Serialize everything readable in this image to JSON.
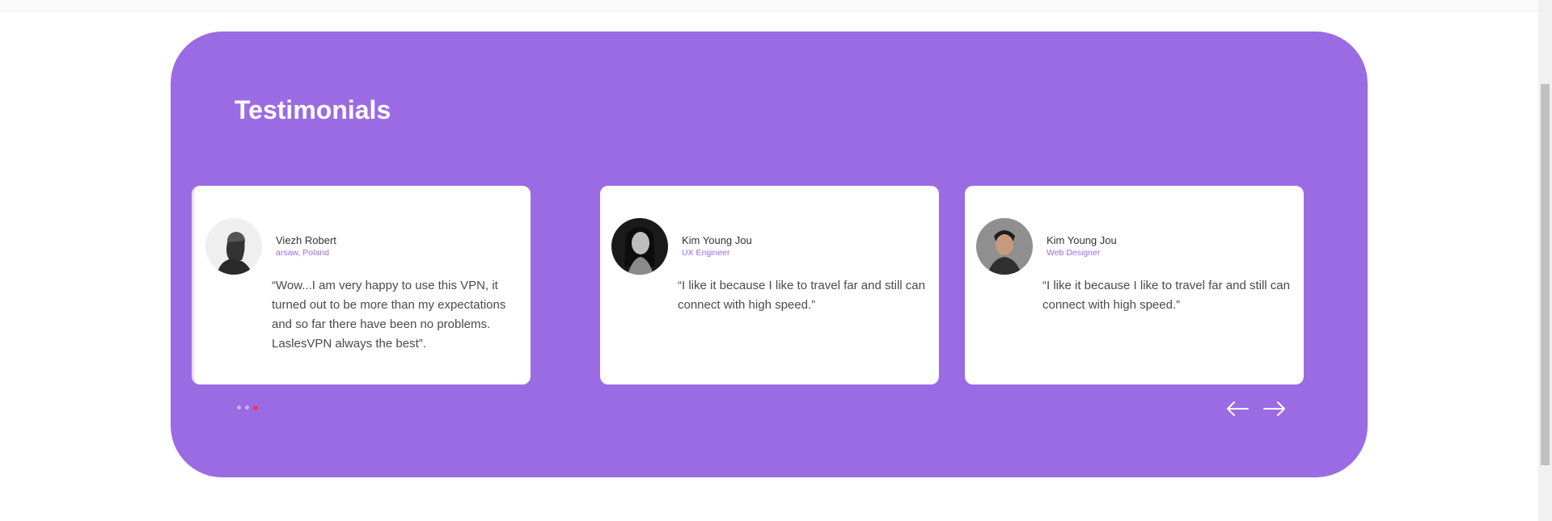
{
  "section": {
    "title": "Testimonials"
  },
  "testimonials": [
    {
      "name": "Viezh Robert",
      "role": "arsaw, Poland",
      "quote": "“Wow...I am very happy to use this VPN, it turned out to be more than my expectations and so far there have been no problems. LaslesVPN always the best”."
    },
    {
      "name": "Kim Young Jou",
      "role": "UX Engineer",
      "quote": "“I like it because I like to travel far and still can connect with high speed.”"
    },
    {
      "name": "Kim Young Jou",
      "role": "Web Designer",
      "quote": "“I like it because I like to travel far and still can connect with high speed.”"
    }
  ],
  "pagination": {
    "count": 3,
    "active_index": 2
  },
  "colors": {
    "panel": "#9b6be3",
    "accent": "#9b6be3",
    "active_dot": "#f53855",
    "card": "#ffffff"
  },
  "icons": {
    "prev": "arrow-left-icon",
    "next": "arrow-right-icon"
  }
}
